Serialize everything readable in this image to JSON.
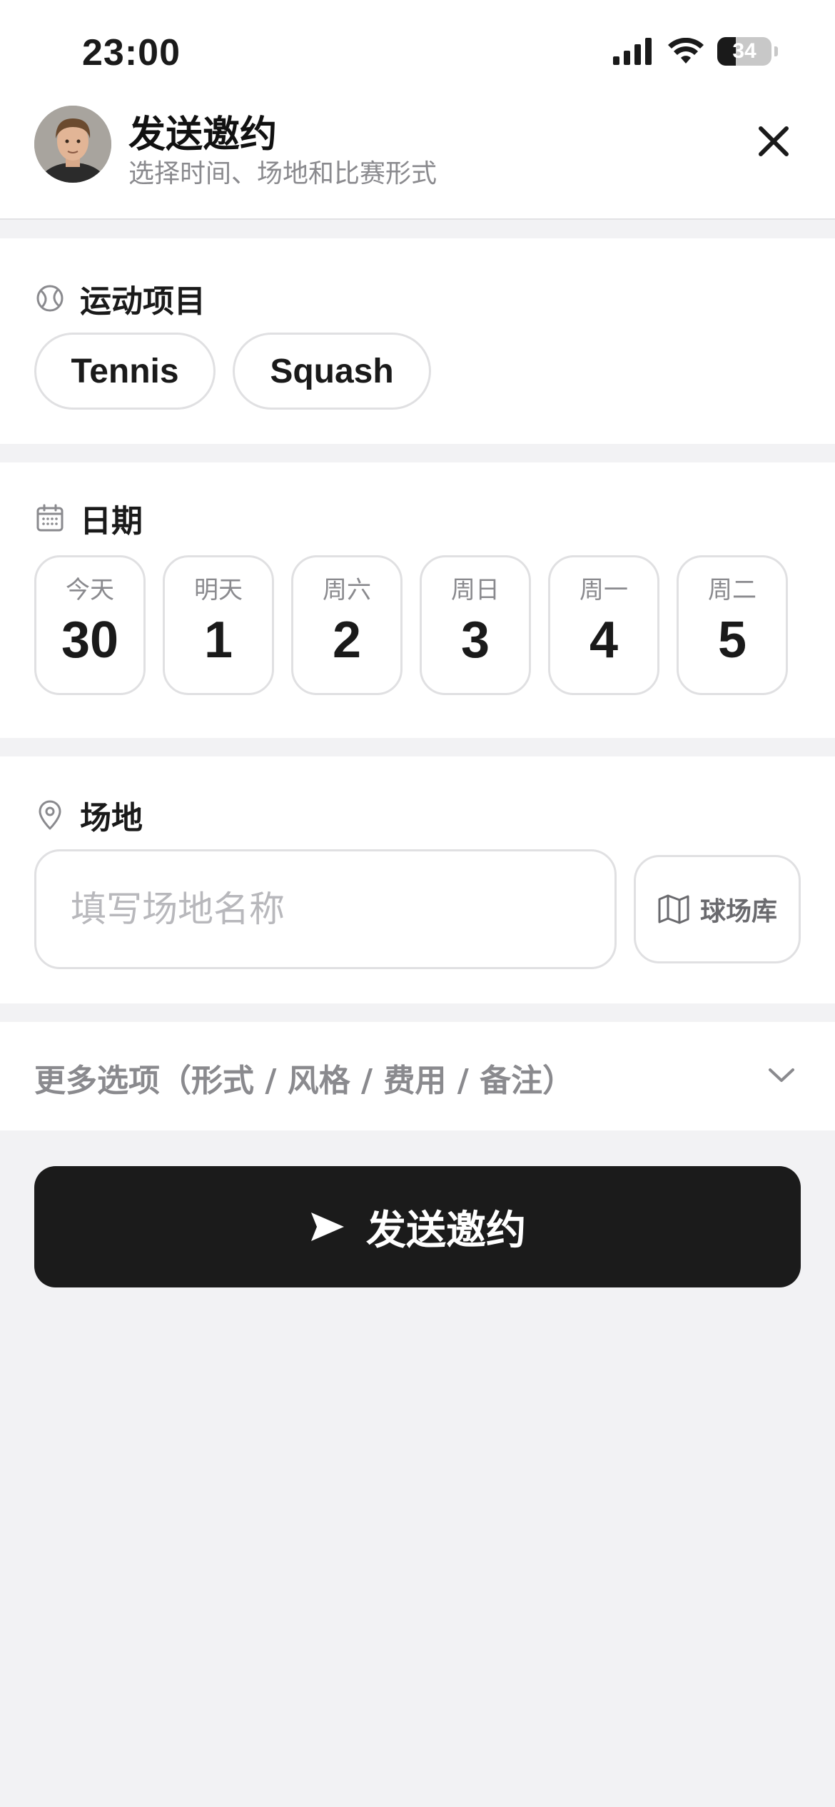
{
  "status_bar": {
    "time": "23:00",
    "battery": "34",
    "battery_level": 0.34
  },
  "header": {
    "title": "发送邀约",
    "subtitle": "选择时间、场地和比赛形式"
  },
  "sport": {
    "label": "运动项目",
    "options": [
      "Tennis",
      "Squash"
    ]
  },
  "date": {
    "label": "日期",
    "days": [
      {
        "weekday": "今天",
        "day": "30"
      },
      {
        "weekday": "明天",
        "day": "1"
      },
      {
        "weekday": "周六",
        "day": "2"
      },
      {
        "weekday": "周日",
        "day": "3"
      },
      {
        "weekday": "周一",
        "day": "4"
      },
      {
        "weekday": "周二",
        "day": "5"
      }
    ]
  },
  "venue": {
    "label": "场地",
    "placeholder": "填写场地名称",
    "value": "",
    "library_button": "球场库"
  },
  "more_options": {
    "label": "更多选项（形式 / 风格 / 费用 / 备注）"
  },
  "send_button": {
    "label": "发送邀约"
  },
  "icons": {
    "sport": "ball-icon",
    "date": "calendar-icon",
    "venue": "map-pin-icon",
    "library": "map-icon",
    "send": "send-icon",
    "close": "close-icon",
    "expand": "chevron-down-icon"
  }
}
